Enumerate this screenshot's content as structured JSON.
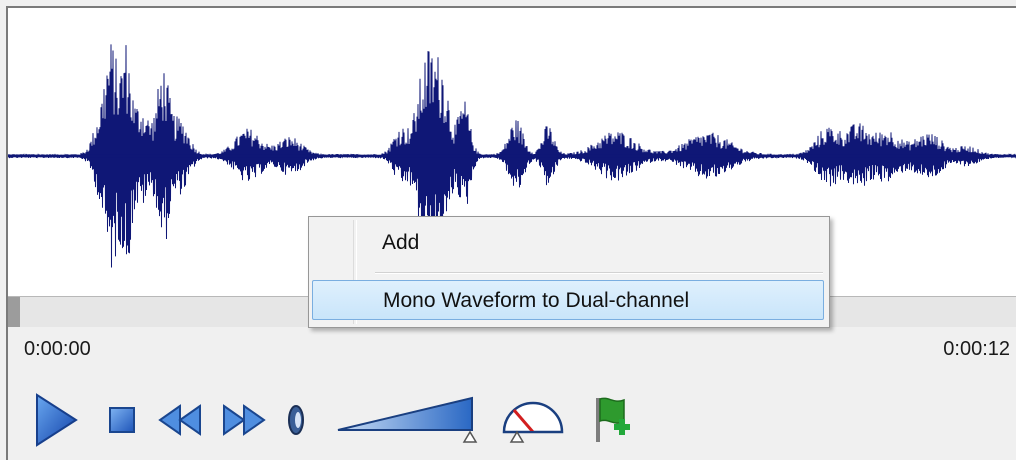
{
  "timeline": {
    "start_time": "0:00:00",
    "end_time": "0:00:12"
  },
  "colors": {
    "waveform": "#0f1776",
    "play_button": "#1e5ec8",
    "flag": "#2e9a2e"
  },
  "context_menu": {
    "items": [
      {
        "label": "Add"
      },
      {
        "label": "Mono Waveform to Dual-channel",
        "highlighted": true
      }
    ]
  },
  "icons": [
    "play-icon",
    "stop-icon",
    "rewind-icon",
    "fast-forward-icon",
    "speaker-icon",
    "volume-slider-icon",
    "speed-gauge-icon",
    "add-marker-flag-icon"
  ]
}
